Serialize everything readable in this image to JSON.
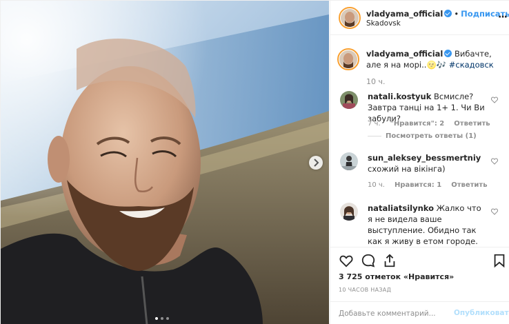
{
  "colors": {
    "accent": "#3897f0",
    "hashtag": "#003569",
    "muted": "#8e8e8e",
    "publish_disabled": "#b2dffc",
    "story_ring": "#f9a030"
  },
  "photo": {
    "icon": "photo",
    "carousel_next_icon": "chevron-right-icon",
    "carousel_dots": 3,
    "active_dot": 1
  },
  "header": {
    "username": "vladyama_official",
    "verified_icon": "verified-badge-icon",
    "separator": "•",
    "follow_label": "Подписаться",
    "location": "Skadovsk",
    "more_icon": "more-options-icon",
    "more_label": "···"
  },
  "caption": {
    "username": "vladyama_official",
    "text": " Вибачте, але я на морі..🌝🎶 ",
    "hashtag": "#скадовск",
    "time": "10 ч."
  },
  "comments": [
    {
      "username": "natali.kostyuk",
      "text": " Всмисле? Завтра танці на 1+ 1. Чи Ви забули?",
      "time": "7 ч.",
      "likes": "\"Нравится\": 2",
      "reply": "Ответить",
      "view_replies": "Посмотреть ответы (1)"
    },
    {
      "username": "sun_aleksey_bessmertniy",
      "text": " схожий на вікінга)",
      "time": "10 ч.",
      "likes": "Нравится: 1",
      "reply": "Ответить"
    },
    {
      "username": "nataliatsilynko",
      "text": " Жалко что я не видела ваше выступление. Обидно так как я живу в етом городе.",
      "time": "",
      "likes": "",
      "reply": ""
    }
  ],
  "actions": {
    "like_icon": "heart-icon",
    "comment_icon": "comment-icon",
    "share_icon": "share-icon",
    "save_icon": "bookmark-icon",
    "likes_count": "3 725",
    "likes_label": " отметок «Нравится»",
    "time_ago": "10 ЧАСОВ НАЗАД"
  },
  "add_comment": {
    "placeholder": "Добавьте комментарий...",
    "publish_label": "Опубликовать"
  }
}
